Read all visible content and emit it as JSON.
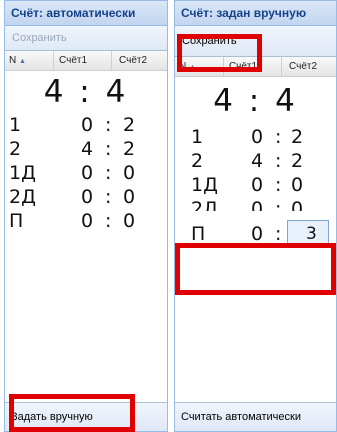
{
  "left_panel": {
    "title": "Счёт: автоматически",
    "save_label": "Сохранить",
    "col_n": "N",
    "col_score1": "Счёт1",
    "col_score2": "Счёт2",
    "total": "4 : 4",
    "rows": [
      {
        "n": "1",
        "s1": "0",
        "s2": "2"
      },
      {
        "n": "2",
        "s1": "4",
        "s2": "2"
      },
      {
        "n": "1Д",
        "s1": "0",
        "s2": "0"
      },
      {
        "n": "2Д",
        "s1": "0",
        "s2": "0"
      },
      {
        "n": "П",
        "s1": "0",
        "s2": "0"
      }
    ],
    "footer_button": "Задать вручную"
  },
  "right_panel": {
    "title": "Счёт: задан вручную",
    "save_label": "Сохранить",
    "col_n": "N",
    "col_score1": "Счёт1",
    "col_score2": "Счёт2",
    "total": "4 : 4",
    "rows": [
      {
        "n": "1",
        "s1": "0",
        "s2": "2"
      },
      {
        "n": "2",
        "s1": "4",
        "s2": "2"
      },
      {
        "n": "1Д",
        "s1": "0",
        "s2": "0"
      },
      {
        "n": "2Д",
        "s1": "0",
        "s2": "0"
      },
      {
        "n": "П",
        "s1": "0",
        "s2": "3"
      }
    ],
    "footer_button": "Считать автоматически"
  },
  "colors": {
    "highlight": "#e00000",
    "header_text": "#15428b",
    "border": "#99bbe8"
  }
}
